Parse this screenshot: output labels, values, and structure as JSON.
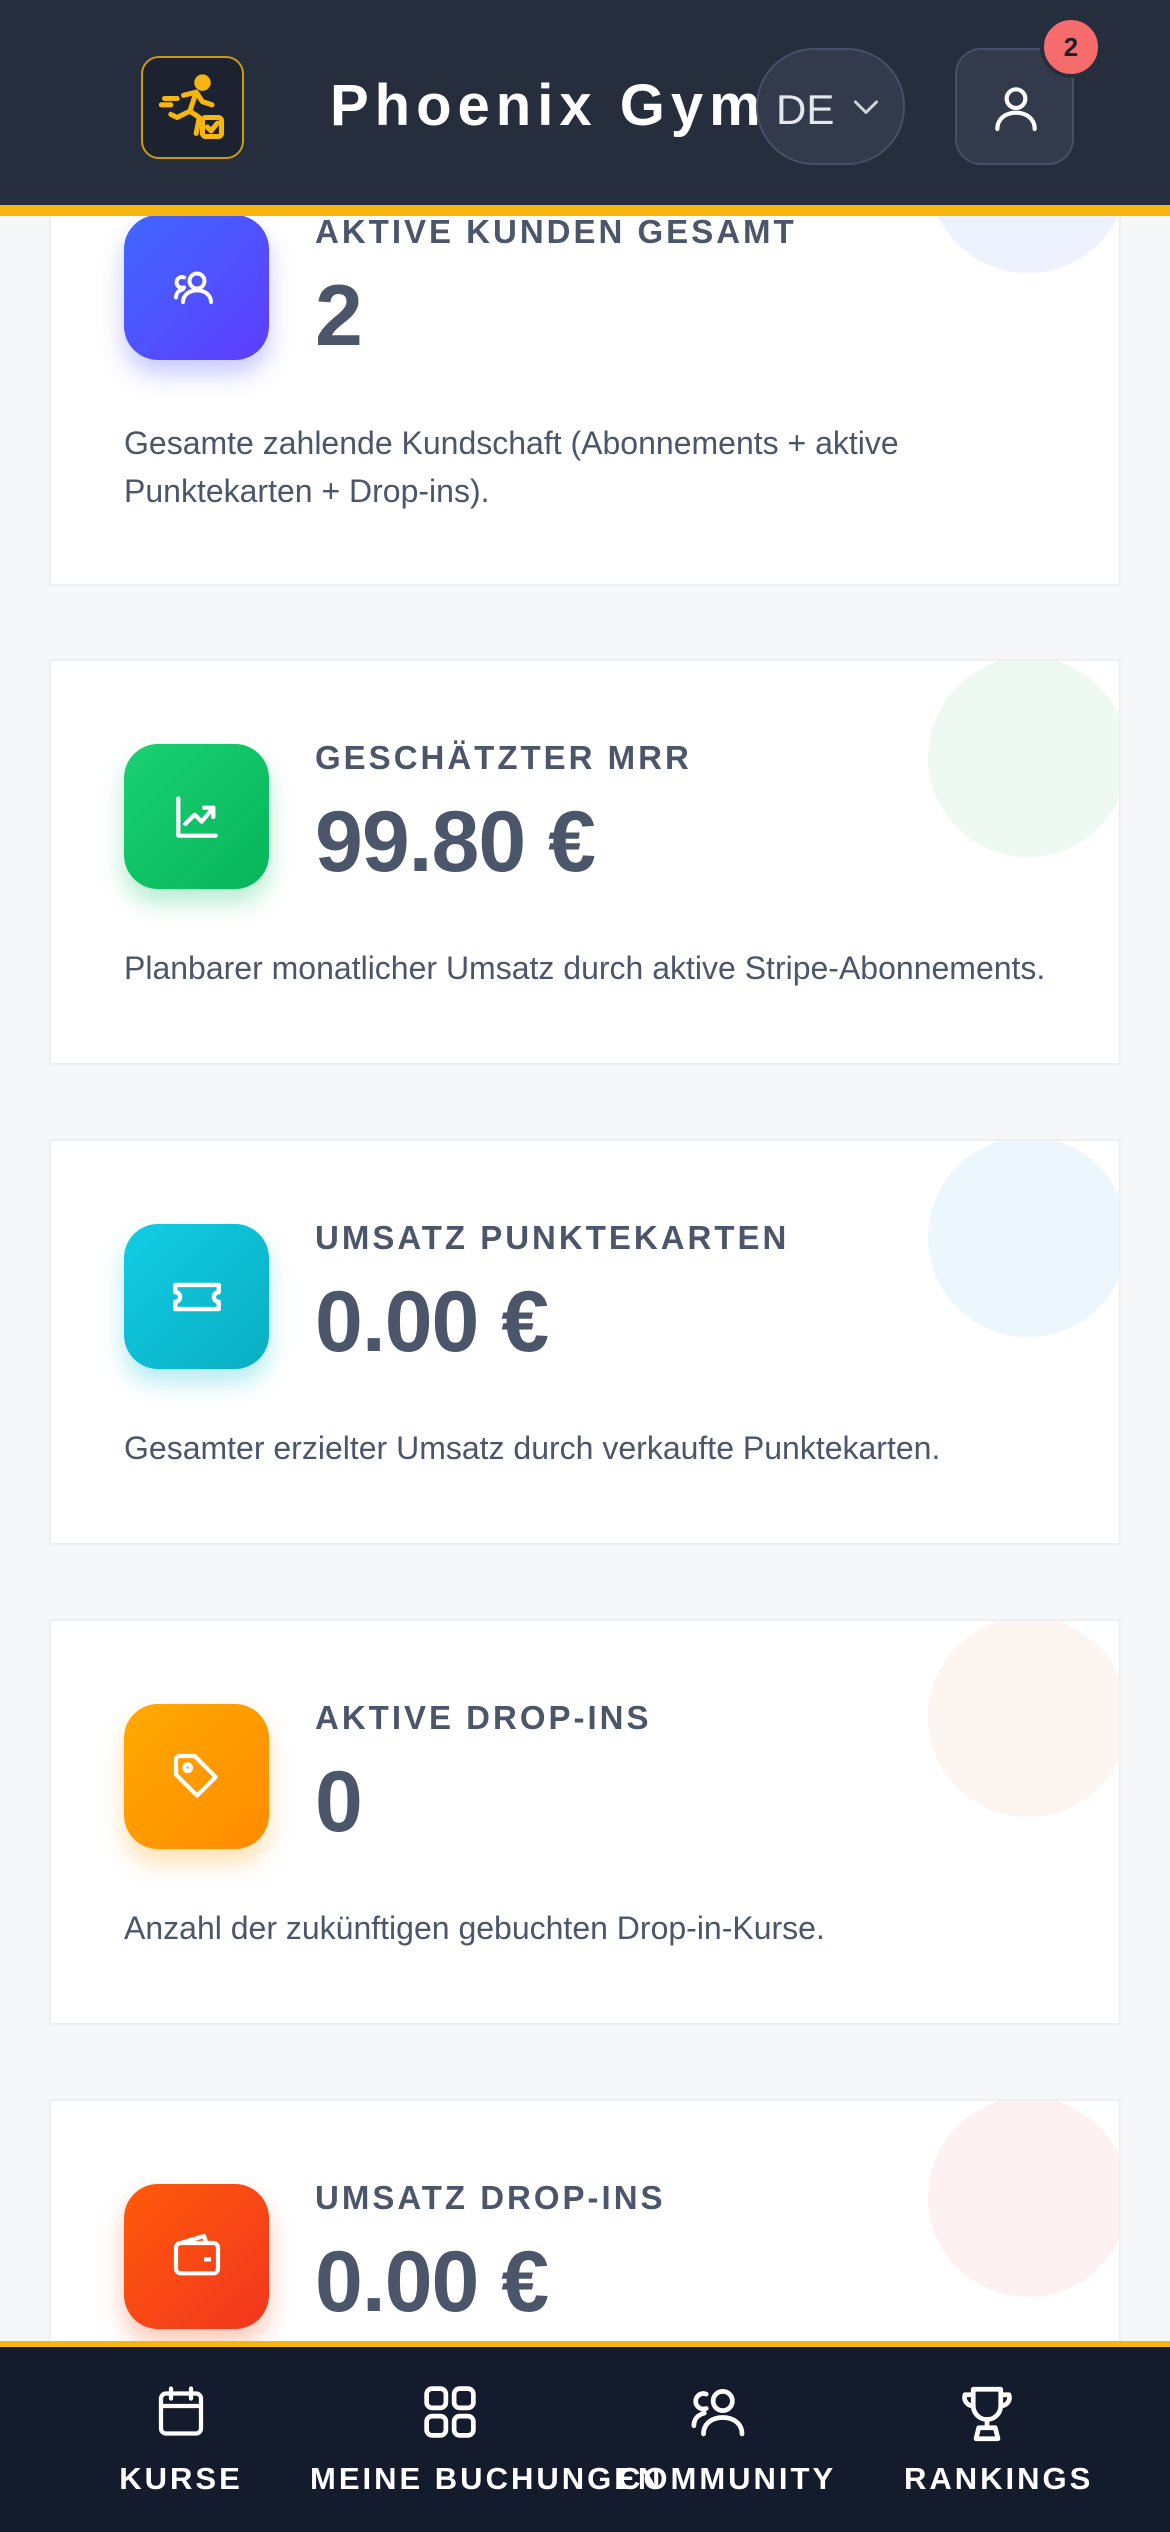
{
  "header": {
    "app_title": "Phoenix Gym",
    "language": "DE",
    "notification_count": "2",
    "accent_color": "#f6b60f",
    "background_color": "#262d3d"
  },
  "cards": [
    {
      "label": "AKTIVE KUNDEN GESAMT",
      "value": "2",
      "description": "Gesamte zahlende Kundschaft (Abonnements + aktive Punktekarten + Drop-ins).",
      "icon": "users-icon",
      "color": "#3c5cff"
    },
    {
      "label": "GESCHÄTZTER MRR",
      "value": "99.80 €",
      "description": "Planbarer monatlicher Umsatz durch aktive Stripe-Abonnements.",
      "icon": "trending-up-icon",
      "color": "#0fc567"
    },
    {
      "label": "UMSATZ PUNKTEKARTEN",
      "value": "0.00 €",
      "description": "Gesamter erzielter Umsatz durch verkaufte Punktekarten.",
      "icon": "ticket-icon",
      "color": "#0cc0d6"
    },
    {
      "label": "AKTIVE DROP-INS",
      "value": "0",
      "description": "Anzahl der zukünftigen gebuchten Drop-in-Kurse.",
      "icon": "tag-icon",
      "color": "#ff9a00"
    },
    {
      "label": "UMSATZ DROP-INS",
      "value": "0.00 €",
      "description": "",
      "icon": "wallet-icon",
      "color": "#ff4a12"
    }
  ],
  "bottom_nav": [
    {
      "label": "KURSE",
      "icon": "calendar-icon"
    },
    {
      "label": "MEINE BUCHUNGEN",
      "icon": "grid-icon"
    },
    {
      "label": "COMMUNITY",
      "icon": "users-icon"
    },
    {
      "label": "RANKINGS",
      "icon": "trophy-icon"
    }
  ]
}
